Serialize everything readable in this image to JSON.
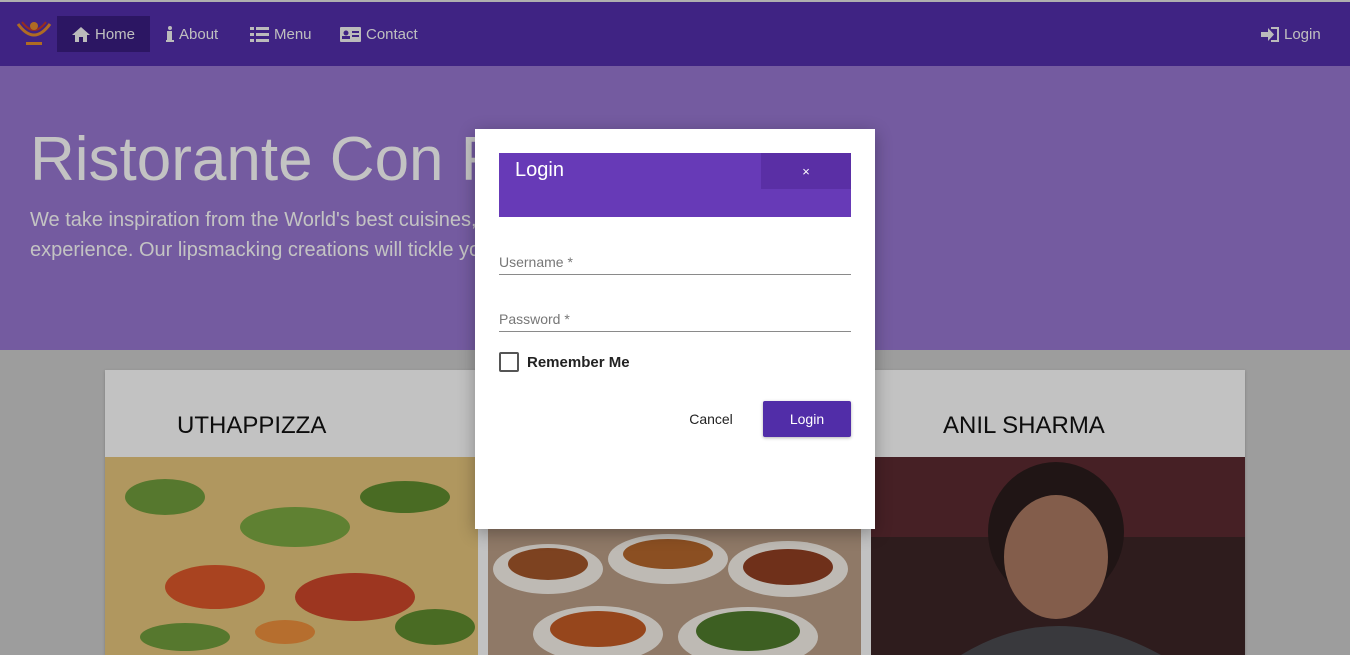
{
  "navbar": {
    "items": [
      {
        "label": "Home",
        "icon": "home-icon",
        "active": true
      },
      {
        "label": "About",
        "icon": "info-icon"
      },
      {
        "label": "Menu",
        "icon": "list-icon"
      },
      {
        "label": "Contact",
        "icon": "address-card-icon"
      }
    ],
    "login_label": "Login",
    "color": "#512da8"
  },
  "jumbotron": {
    "title": "Ristorante Con Fusion",
    "text": "We take inspiration from the World's best cuisines, and create a unique fusion experience. Our lipsmacking creations will tickle your culinary senses!",
    "color": "#9575cd"
  },
  "cards": [
    {
      "title": "UTHAPPIZZA"
    },
    {
      "title": ""
    },
    {
      "title": "ANIL SHARMA"
    }
  ],
  "modal": {
    "title": "Login",
    "close_label": "×",
    "username_label": "Username *",
    "password_label": "Password *",
    "remember_label": "Remember Me",
    "cancel_label": "Cancel",
    "login_label": "Login",
    "header_color": "#673ab7"
  }
}
